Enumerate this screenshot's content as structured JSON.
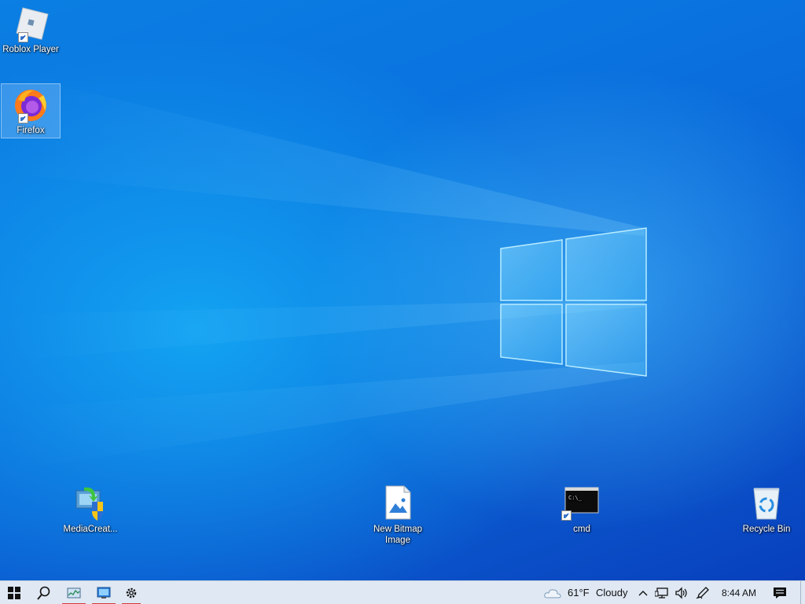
{
  "desktop": {
    "icons": {
      "roblox": {
        "label": "Roblox Player",
        "icon": "roblox-icon"
      },
      "firefox": {
        "label": "Firefox",
        "icon": "firefox-icon"
      },
      "mediacreation": {
        "label": "MediaCreat...",
        "icon": "media-creation-tool-icon"
      },
      "bitmap": {
        "label_line1": "New Bitmap",
        "label_line2": "Image",
        "icon": "bitmap-file-icon"
      },
      "cmd": {
        "label": "cmd",
        "icon": "cmd-icon"
      },
      "recycle": {
        "label": "Recycle Bin",
        "icon": "recycle-bin-icon"
      }
    }
  },
  "taskbar": {
    "weather": {
      "temp": "61°F",
      "condition": "Cloudy"
    },
    "time": "8:44 AM",
    "colors": {
      "background": "#dfe8f3",
      "running_indicator": "#d23a3a"
    }
  }
}
